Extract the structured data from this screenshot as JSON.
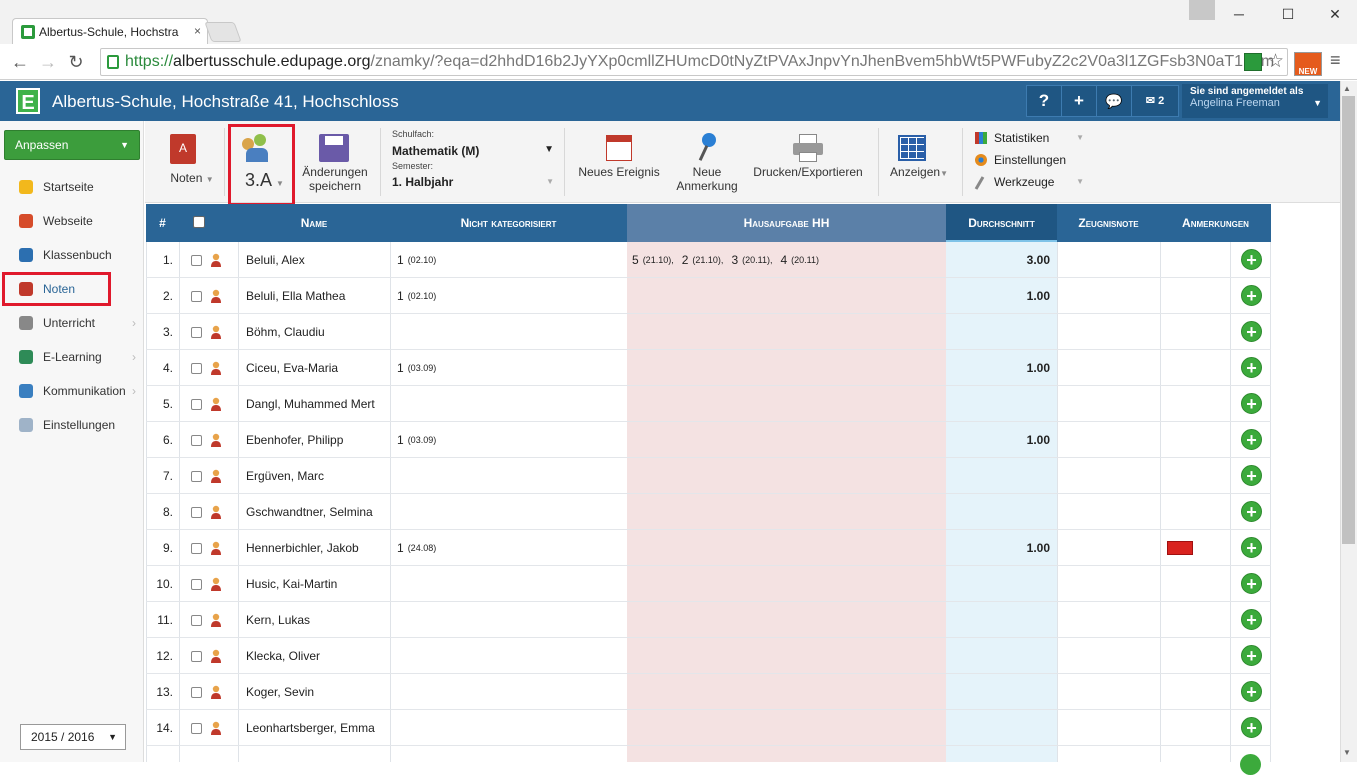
{
  "browser": {
    "tab_title": "Albertus-Schule, Hochstra",
    "tab_close": "×",
    "url_scheme": "https://",
    "url_host": "albertusschule.edupage.org",
    "url_path": "/znamky/?eqa=d2hhdD16b2JyYXp0cmllZHUmcD0tNyZtPVAxJnpvYnJhenBvem5hbWt5PWFubyZ2c2V0a3l1ZGFsb3N0aT1hbm",
    "new_badge": "NEW"
  },
  "app": {
    "logo": "E",
    "title": "Albertus-Schule, Hochstraße 41, Hochschloss",
    "help": "?",
    "add": "+",
    "msg_count": "2",
    "login_label": "Sie sind angemeldet als",
    "user": "Angelina Freeman"
  },
  "sidebar": {
    "customize": "Anpassen",
    "items": [
      {
        "label": "Startseite",
        "color": "#f2b81c"
      },
      {
        "label": "Webseite",
        "color": "#d64c2a"
      },
      {
        "label": "Klassenbuch",
        "color": "#2c6fb0"
      },
      {
        "label": "Noten",
        "color": "#c0392b"
      },
      {
        "label": "Unterricht",
        "color": "#888888"
      },
      {
        "label": "E-Learning",
        "color": "#2e8b57"
      },
      {
        "label": "Kommunikation",
        "color": "#3a7fc0"
      },
      {
        "label": "Einstellungen",
        "color": "#9fb3c8"
      }
    ],
    "year": "2015 / 2016"
  },
  "toolbar": {
    "noten": "Noten",
    "class": "3.A",
    "save": "Änderungen speichern",
    "subject_label": "Schulfach:",
    "subject": "Mathematik (M)",
    "semester_label": "Semester:",
    "semester": "1. Halbjahr",
    "new_event": "Neues Ereignis",
    "new_note": "Neue Anmerkung",
    "print": "Drucken/Exportieren",
    "show": "Anzeigen",
    "stats": "Statistiken",
    "settings": "Einstellungen",
    "tools": "Werkzeuge"
  },
  "table": {
    "headers": {
      "num": "#",
      "name": "Name",
      "uncat": "Nicht kategorisiert",
      "homework": "Hausaufgabe HH",
      "avg": "Durchschnitt",
      "report": "Zeugnisnote",
      "notes": "Anmerkungen"
    },
    "rows": [
      {
        "num": "1.",
        "name": "Beluli, Alex",
        "uncat": [
          {
            "g": "1",
            "d": "(02.10)"
          }
        ],
        "hw": [
          {
            "g": "5",
            "d": "(21.10),"
          },
          {
            "g": "2",
            "d": "(21.10),"
          },
          {
            "g": "3",
            "d": "(20.11),"
          },
          {
            "g": "4",
            "d": "(20.11)"
          }
        ],
        "avg": "3.00"
      },
      {
        "num": "2.",
        "name": "Beluli, Ella Mathea",
        "uncat": [
          {
            "g": "1",
            "d": "(02.10)"
          }
        ],
        "hw": [],
        "avg": "1.00"
      },
      {
        "num": "3.",
        "name": "Böhm, Claudiu",
        "uncat": [],
        "hw": [],
        "avg": ""
      },
      {
        "num": "4.",
        "name": "Ciceu, Eva-Maria",
        "uncat": [
          {
            "g": "1",
            "d": "(03.09)"
          }
        ],
        "hw": [],
        "avg": "1.00"
      },
      {
        "num": "5.",
        "name": "Dangl, Muhammed Mert",
        "uncat": [],
        "hw": [],
        "avg": ""
      },
      {
        "num": "6.",
        "name": "Ebenhofer, Philipp",
        "uncat": [
          {
            "g": "1",
            "d": "(03.09)"
          }
        ],
        "hw": [],
        "avg": "1.00"
      },
      {
        "num": "7.",
        "name": "Ergüven, Marc",
        "uncat": [],
        "hw": [],
        "avg": ""
      },
      {
        "num": "8.",
        "name": "Gschwandtner, Selmina",
        "uncat": [],
        "hw": [],
        "avg": ""
      },
      {
        "num": "9.",
        "name": "Hennerbichler, Jakob",
        "uncat": [
          {
            "g": "1",
            "d": "(24.08)"
          }
        ],
        "hw": [],
        "avg": "1.00",
        "mail": true
      },
      {
        "num": "10.",
        "name": "Husic, Kai-Martin",
        "uncat": [],
        "hw": [],
        "avg": ""
      },
      {
        "num": "11.",
        "name": "Kern, Lukas",
        "uncat": [],
        "hw": [],
        "avg": ""
      },
      {
        "num": "12.",
        "name": "Klecka, Oliver",
        "uncat": [],
        "hw": [],
        "avg": ""
      },
      {
        "num": "13.",
        "name": "Koger, Sevin",
        "uncat": [],
        "hw": [],
        "avg": ""
      },
      {
        "num": "14.",
        "name": "Leonhartsberger, Emma",
        "uncat": [],
        "hw": [],
        "avg": ""
      }
    ]
  },
  "colors": {
    "header_blue": "#2a6596",
    "accent_green": "#3c9d3c",
    "highlight_red": "#e0192c"
  }
}
